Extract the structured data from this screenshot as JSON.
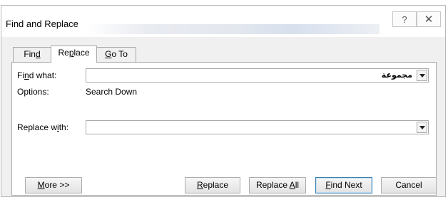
{
  "window": {
    "title": "Find and Replace",
    "help_glyph": "?",
    "close_glyph": "✕"
  },
  "tabs": [
    {
      "pre": "Fin",
      "key": "d",
      "post": "",
      "active": false
    },
    {
      "pre": "Re",
      "key": "p",
      "post": "lace",
      "active": true
    },
    {
      "pre": "",
      "key": "G",
      "post": "o To",
      "active": false
    }
  ],
  "find": {
    "label_pre": "Fi",
    "label_key": "n",
    "label_post": "d what:",
    "value": "مجموعة"
  },
  "options": {
    "label": "Options:",
    "value": "Search Down"
  },
  "replace": {
    "label_pre": "Replace w",
    "label_key": "i",
    "label_post": "th:",
    "value": ""
  },
  "buttons": {
    "more": {
      "pre": "",
      "key": "M",
      "post": "ore >>"
    },
    "replace": {
      "pre": "",
      "key": "R",
      "post": "eplace"
    },
    "replace_all": {
      "pre": "Replace ",
      "key": "A",
      "post": "ll"
    },
    "find_next": {
      "pre": "",
      "key": "F",
      "post": "ind Next"
    },
    "cancel": {
      "label": "Cancel"
    }
  },
  "colors": {
    "dialog_bg": "#f0f0f0",
    "focus_border": "#3c7fb1"
  }
}
